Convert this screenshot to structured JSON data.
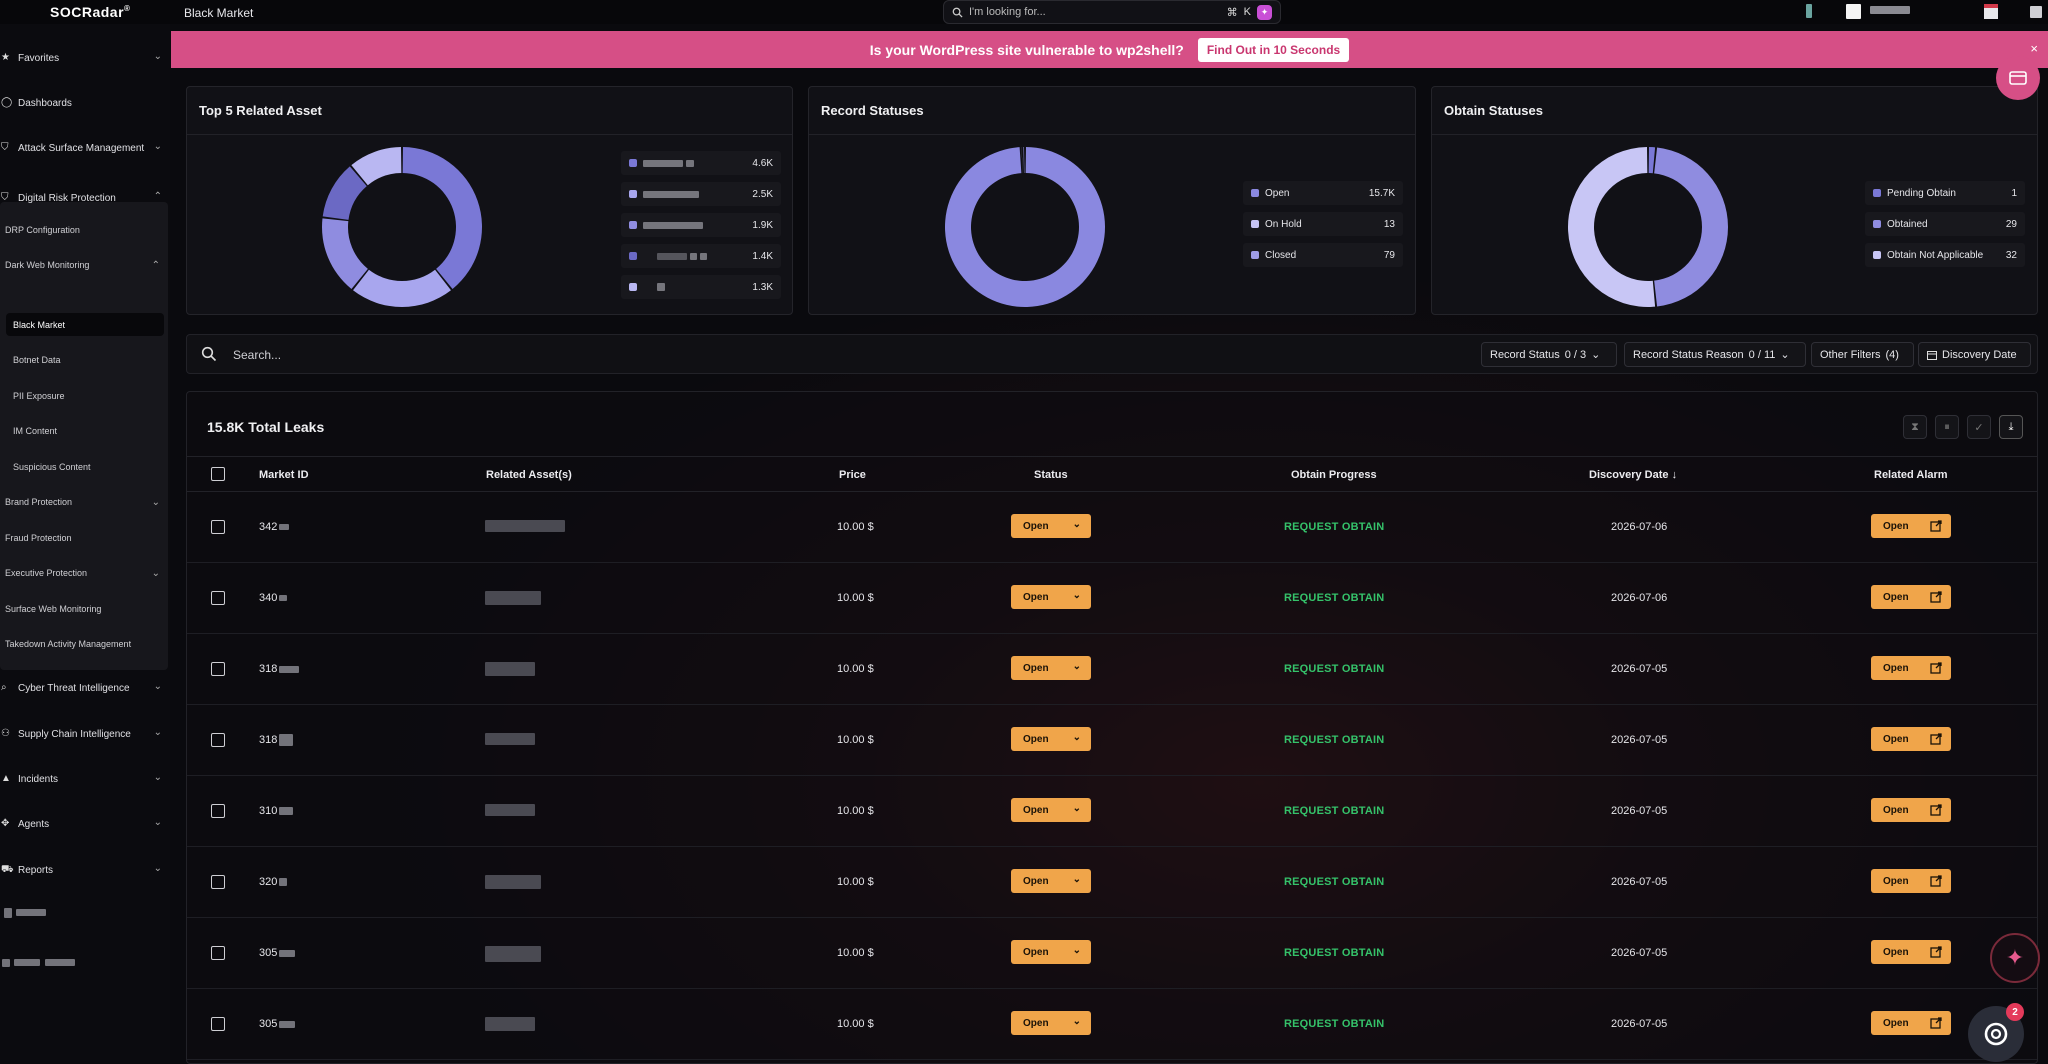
{
  "app": {
    "logo": "SOCRadar",
    "logo_mark": "®",
    "page_title": "Black Market"
  },
  "search": {
    "placeholder": "I'm looking for...",
    "shortcut_cmd": "⌘",
    "shortcut_key": "K"
  },
  "banner": {
    "text": "Is your WordPress site vulnerable to wp2shell?",
    "cta": "Find Out in 10 Seconds",
    "close": "×",
    "color": "#d64f86"
  },
  "sidebar": {
    "favorites": "Favorites",
    "dashboards": "Dashboards",
    "asm": "Attack Surface Management",
    "drp": "Digital Risk Protection",
    "drp_config": "DRP Configuration",
    "dark_web": "Dark Web Monitoring",
    "black_market": "Black Market",
    "botnet": "Botnet Data",
    "pii": "PII Exposure",
    "im_content": "IM Content",
    "suspicious": "Suspicious Content",
    "brand": "Brand Protection",
    "fraud": "Fraud Protection",
    "executive": "Executive Protection",
    "surface_web": "Surface Web Monitoring",
    "takedown": "Takedown Activity Management",
    "cti": "Cyber Threat Intelligence",
    "supply_chain": "Supply Chain Intelligence",
    "incidents": "Incidents",
    "agents": "Agents",
    "reports": "Reports"
  },
  "cards": {
    "top5": {
      "title": "Top 5 Related Asset",
      "values": [
        "4.6K",
        "2.5K",
        "1.9K",
        "1.4K",
        "1.3K"
      ],
      "colors": [
        "#7a78d6",
        "#a8a6ee",
        "#8f8ce0",
        "#6b69c4",
        "#b9b7f2"
      ]
    },
    "record": {
      "title": "Record Statuses",
      "labels": [
        "Open",
        "On Hold",
        "Closed"
      ],
      "values": [
        "15.7K",
        "13",
        "79"
      ],
      "colors": [
        "#8a88e0",
        "#c5c3f4",
        "#9e9ce6"
      ]
    },
    "obtain": {
      "title": "Obtain Statuses",
      "labels": [
        "Pending Obtain",
        "Obtained",
        "Obtain Not Applicable"
      ],
      "values": [
        "1",
        "29",
        "32"
      ],
      "colors": [
        "#7a78d6",
        "#8f8ce0",
        "#c8c6f5"
      ]
    }
  },
  "filters": {
    "search_placeholder": "Search...",
    "record_status": "Record Status",
    "record_status_count": "0 / 3",
    "record_status_reason": "Record Status Reason",
    "record_status_reason_count": "0 / 11",
    "other_filters": "Other Filters",
    "other_filters_count": "(4)",
    "discovery_date": "Discovery Date"
  },
  "table": {
    "total": "15.8K Total Leaks",
    "columns": [
      "Market ID",
      "Related Asset(s)",
      "Price",
      "Status",
      "Obtain Progress",
      "Discovery Date",
      "Related Alarm"
    ],
    "sort_indicator": "↓",
    "rows": [
      {
        "id": "342",
        "price": "10.00 $",
        "status": "Open",
        "progress": "REQUEST OBTAIN",
        "date": "2026-07-06",
        "alarm": "Open"
      },
      {
        "id": "340",
        "price": "10.00 $",
        "status": "Open",
        "progress": "REQUEST OBTAIN",
        "date": "2026-07-06",
        "alarm": "Open"
      },
      {
        "id": "318",
        "price": "10.00 $",
        "status": "Open",
        "progress": "REQUEST OBTAIN",
        "date": "2026-07-05",
        "alarm": "Open"
      },
      {
        "id": "318",
        "price": "10.00 $",
        "status": "Open",
        "progress": "REQUEST OBTAIN",
        "date": "2026-07-05",
        "alarm": "Open"
      },
      {
        "id": "310",
        "price": "10.00 $",
        "status": "Open",
        "progress": "REQUEST OBTAIN",
        "date": "2026-07-05",
        "alarm": "Open"
      },
      {
        "id": "320",
        "price": "10.00 $",
        "status": "Open",
        "progress": "REQUEST OBTAIN",
        "date": "2026-07-05",
        "alarm": "Open"
      },
      {
        "id": "305",
        "price": "10.00 $",
        "status": "Open",
        "progress": "REQUEST OBTAIN",
        "date": "2026-07-05",
        "alarm": "Open"
      },
      {
        "id": "305",
        "price": "10.00 $",
        "status": "Open",
        "progress": "REQUEST OBTAIN",
        "date": "2026-07-05",
        "alarm": "Open"
      }
    ]
  },
  "help": {
    "badge": "2"
  },
  "icons": {
    "search": "search-icon",
    "star": "star-icon",
    "shield": "shield-icon",
    "calendar": "calendar-icon",
    "download": "download-icon",
    "external": "external-link-icon",
    "sparkle": "sparkle-icon"
  }
}
